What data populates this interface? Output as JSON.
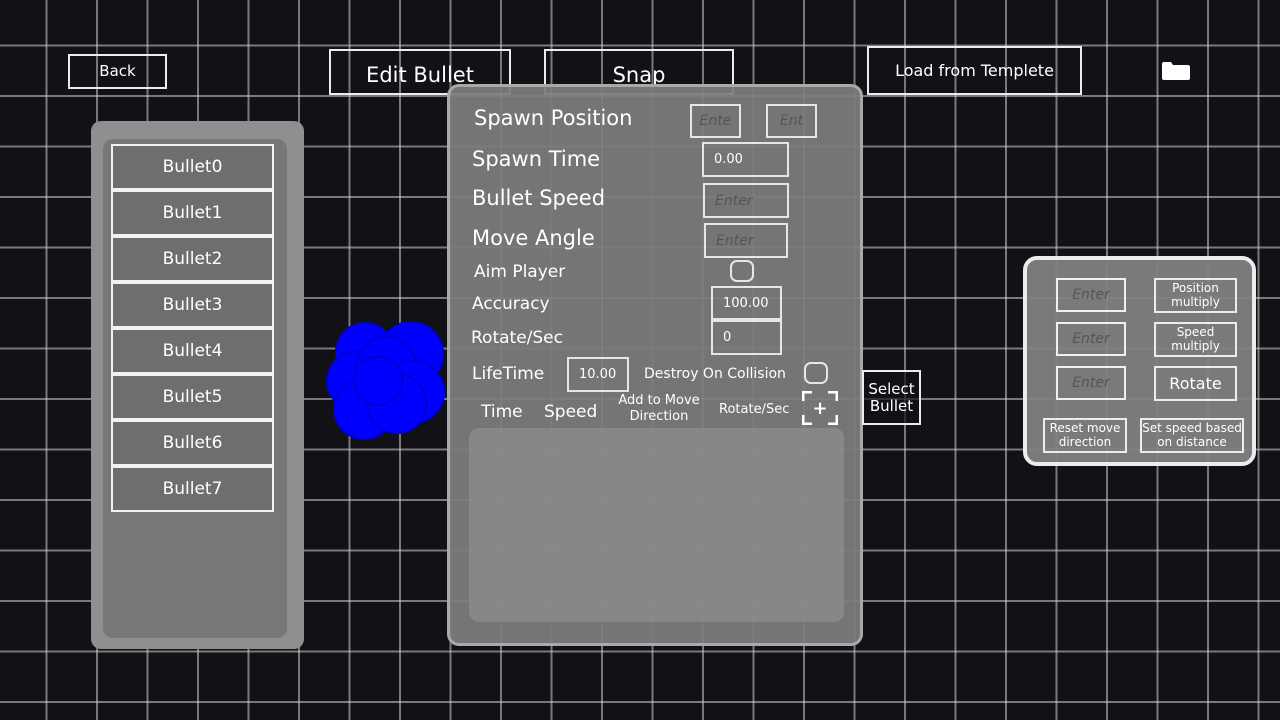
{
  "top_bar": {
    "back_label": "Back",
    "edit_bullet_label": "Edit Bullet",
    "snap_label": "Snap",
    "load_template_label": "Load from Templete",
    "folder_icon": "folder-icon"
  },
  "bullet_list": {
    "items": [
      "Bullet0",
      "Bullet1",
      "Bullet2",
      "Bullet3",
      "Bullet4",
      "Bullet5",
      "Bullet6",
      "Bullet7"
    ]
  },
  "editor": {
    "spawn_position_label": "Spawn Position",
    "spawn_x_placeholder": "Ente",
    "spawn_y_placeholder": "Ent",
    "spawn_time_label": "Spawn Time",
    "spawn_time_value": "0.00",
    "bullet_speed_label": "Bullet Speed",
    "bullet_speed_placeholder": "Enter",
    "move_angle_label": "Move Angle",
    "move_angle_placeholder": "Enter",
    "aim_player_label": "Aim Player",
    "accuracy_label": "Accuracy",
    "accuracy_value": "100.00",
    "rotate_sec_label": "Rotate/Sec",
    "rotate_sec_value": "0",
    "lifetime_label": "LifeTime",
    "lifetime_value": "10.00",
    "destroy_on_collision_label": "Destroy On Collision",
    "keyframe_headers": {
      "time": "Time",
      "speed": "Speed",
      "add_to_move_direction": "Add to Move Direction",
      "rotate_sec": "Rotate/Sec"
    },
    "add_keyframe_symbol": "+"
  },
  "select_bullet_label": "Select Bullet",
  "right_panel": {
    "field_placeholder": "Enter",
    "position_multiply_label": "Position multiply",
    "speed_multiply_label": "Speed multiply",
    "rotate_label": "Rotate",
    "reset_move_direction_label": "Reset move direction",
    "set_speed_distance_label": "Set speed based on distance"
  },
  "colors": {
    "grid_background": "#111116",
    "bullet_blue": "#0000ff",
    "panel_gray": "#7a7a7a"
  }
}
